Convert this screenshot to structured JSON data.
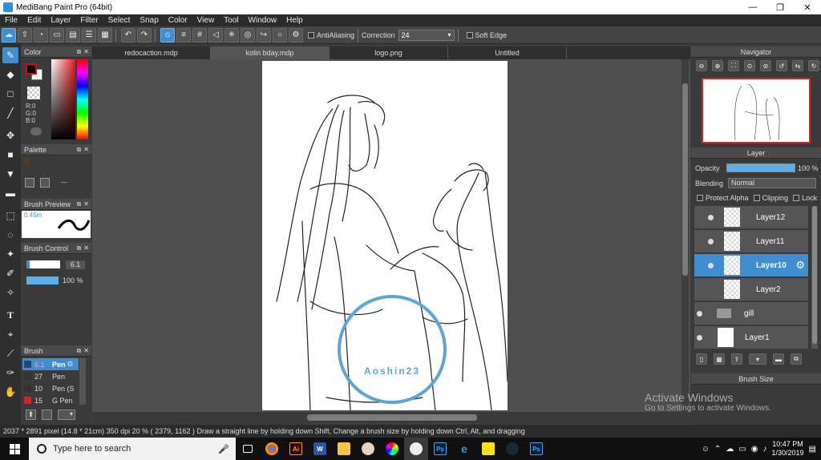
{
  "window": {
    "title": "MediBang Paint Pro (64bit)",
    "controls": [
      "—",
      "❐",
      "✕"
    ]
  },
  "menu": [
    "File",
    "Edit",
    "Layer",
    "Filter",
    "Select",
    "Snap",
    "Color",
    "View",
    "Tool",
    "Window",
    "Help"
  ],
  "toolbar": {
    "antialiasing_label": "AntiAliasing",
    "correction_label": "Correction",
    "correction_value": "24",
    "soft_edge_label": "Soft Edge"
  },
  "panels": {
    "color": {
      "title": "Color",
      "rgb": [
        "R:0",
        "G:0",
        "B:0"
      ],
      "fg_color": "#000000",
      "bg_color": "#ffffff"
    },
    "palette": {
      "title": "Palette",
      "more": "---"
    },
    "brush_preview": {
      "title": "Brush Preview",
      "size": "0.45m"
    },
    "brush_control": {
      "title": "Brush Control",
      "size": "6.1",
      "opacity": "100 %"
    },
    "brush": {
      "title": "Brush",
      "items": [
        {
          "size": "6.1",
          "name": "Pen",
          "color": "#2d6fb0",
          "selected": true
        },
        {
          "size": "27",
          "name": "Pen",
          "color": "#333333",
          "selected": false
        },
        {
          "size": "10",
          "name": "Pen (S",
          "color": "#333333",
          "selected": false
        },
        {
          "size": "15",
          "name": "G Pen",
          "color": "#e02020",
          "selected": false
        }
      ]
    },
    "navigator": {
      "title": "Navigator"
    },
    "layer": {
      "title": "Layer",
      "opacity_label": "Opacity",
      "opacity_value": "100 %",
      "blending_label": "Blending",
      "blending_value": "Normal",
      "protect_alpha": "Protect Alpha",
      "clipping": "Clipping",
      "lock": "Lock",
      "layers": [
        {
          "name": "Layer12",
          "selected": false
        },
        {
          "name": "Layer11",
          "selected": false
        },
        {
          "name": "Layer10",
          "selected": true
        },
        {
          "name": "Layer2",
          "selected": false
        },
        {
          "name": "gill",
          "selected": false
        },
        {
          "name": "Layer1",
          "selected": false
        }
      ]
    },
    "brush_size": {
      "title": "Brush Size"
    }
  },
  "documents": [
    "redocaction.mdp",
    "kolin bday.mdp",
    "logo.png",
    "Untitled"
  ],
  "active_document": "kolin bday.mdp",
  "watermark_text": "Aoshin23",
  "status_bar": "2037 * 2891 pixel   (14.8 * 21cm)   350 dpi   20 %   ( 2379, 1162 )   Draw a straight line by holding down Shift, Change a brush size by holding down Ctrl, Alt, and dragging",
  "windows_watermark": {
    "line1": "Activate Windows",
    "line2": "Go to Settings to activate Windows."
  },
  "taskbar": {
    "search_placeholder": "Type here to search",
    "time": "10:47 PM",
    "date": "1/30/2019"
  },
  "colors": {
    "accent": "#3f8fd0",
    "panel_bg": "#3a3a3a",
    "canvas_bg": "#4f4f4f"
  }
}
